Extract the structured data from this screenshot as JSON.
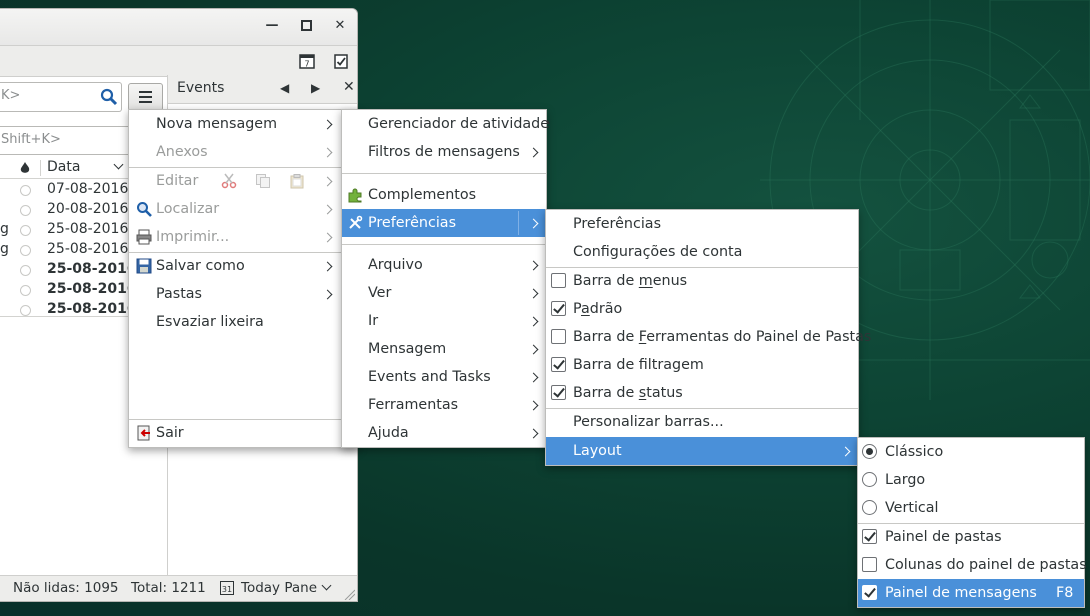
{
  "window": {
    "search_placeholder": "K>",
    "filter_placeholder": "Shift+K>",
    "events_label": "Events",
    "column_date": "Data",
    "rows": [
      {
        "sender": "",
        "date": "07-08-2016",
        "unread": false
      },
      {
        "sender": "",
        "date": "20-08-2016",
        "unread": false
      },
      {
        "sender": "g",
        "date": "25-08-2016",
        "unread": false
      },
      {
        "sender": "g",
        "date": "25-08-2016",
        "unread": false
      },
      {
        "sender": "",
        "date": "25-08-2016",
        "unread": true
      },
      {
        "sender": "",
        "date": "25-08-2016",
        "unread": true
      },
      {
        "sender": "",
        "date": "25-08-2016",
        "unread": true
      }
    ],
    "status": {
      "unread": "Não lidas: 1095",
      "total": "Total: 1211",
      "today_pane": "Today Pane",
      "calendar_day": "31"
    }
  },
  "menu_main": {
    "new_message": "Nova mensagem",
    "attachments": "Anexos",
    "edit": "Editar",
    "find": "Localizar",
    "print": "Imprimir...",
    "save_as": "Salvar como",
    "folders": "Pastas",
    "empty_trash": "Esvaziar lixeira",
    "quit": "Sair"
  },
  "menu_tools": {
    "activity_manager": "Gerenciador de atividade",
    "message_filters": "Filtros de mensagens",
    "addons": "Complementos",
    "preferences": "Preferências",
    "file": "Arquivo",
    "view": "Ver",
    "go": "Ir",
    "message": "Mensagem",
    "events_tasks": "Events and Tasks",
    "tools": "Ferramentas",
    "help": "Ajuda"
  },
  "menu_preferences": {
    "preferences": "Preferências",
    "account_settings": "Configurações de conta",
    "menu_bar": {
      "pre": "Barra de ",
      "ul": "m",
      "post": "enus",
      "checked": false
    },
    "default": {
      "pre": "P",
      "ul": "a",
      "post": "drão",
      "checked": true
    },
    "folder_toolbar": {
      "pre": "Barra de ",
      "ul": "F",
      "post": "erramentas do Painel de Pastas",
      "checked": false
    },
    "filter_bar": {
      "pre": "Barra de filtragem",
      "ul": "",
      "post": "",
      "checked": true
    },
    "status_bar": {
      "pre": "Barra de ",
      "ul": "s",
      "post": "tatus",
      "checked": true
    },
    "customize": "Personalizar barras...",
    "layout": "Layout"
  },
  "menu_layout": {
    "classic": {
      "label": "Clássico",
      "selected": true
    },
    "wide": {
      "label": "Largo",
      "selected": false
    },
    "vertical": {
      "label": "Vertical",
      "selected": false
    },
    "folder_pane": {
      "label": "Painel de pastas",
      "checked": true
    },
    "folder_pane_columns": {
      "label": "Colunas do painel de pastas",
      "checked": false
    },
    "message_pane": {
      "label": "Painel de mensagens",
      "checked": true,
      "shortcut": "F8"
    }
  },
  "colors": {
    "highlight": "#4a90d9",
    "desktop": "#0b3a2e"
  }
}
